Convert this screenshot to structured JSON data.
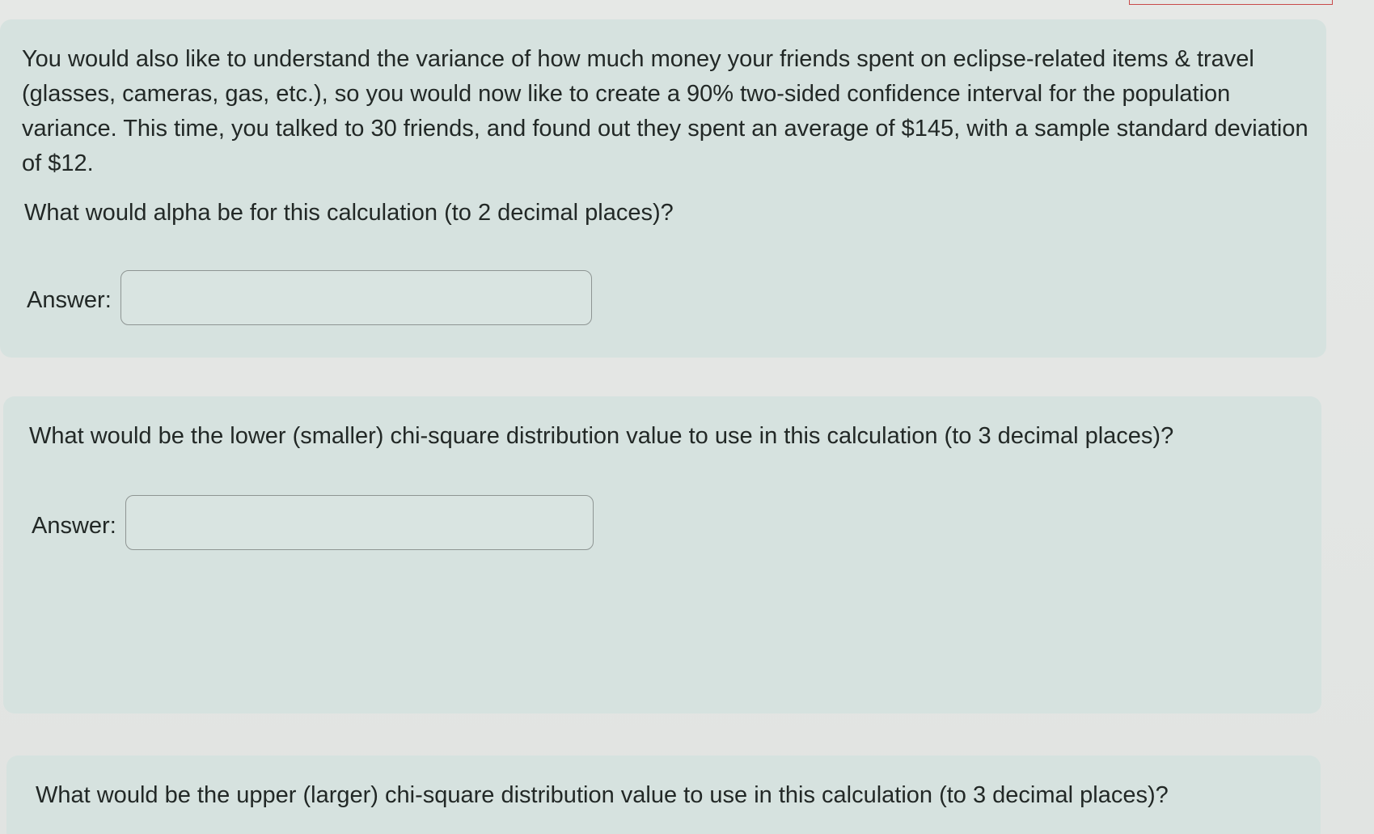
{
  "questions": {
    "intro": "You would also like to understand the variance of how much money your friends spent on eclipse-related items & travel (glasses, cameras, gas, etc.), so you would now like to create a 90% two-sided confidence interval for the population variance.  This time, you talked to 30 friends, and found out they spent an average of $145, with a sample standard deviation of $12.",
    "q1": {
      "prompt": "What would alpha be for this calculation (to 2 decimal places)?",
      "answer_label": "Answer:",
      "answer_value": ""
    },
    "q2": {
      "prompt": "What would be the lower (smaller) chi-square distribution value to use in this calculation (to 3 decimal places)?",
      "answer_label": "Answer:",
      "answer_value": ""
    },
    "q3": {
      "prompt": "What would be the upper (larger) chi-square distribution value to use in this calculation (to 3 decimal places)?"
    }
  },
  "colors": {
    "panel_background": "#d6e2df",
    "page_background": "#e1e4e2",
    "text": "#222826",
    "input_border": "#8e9593"
  }
}
